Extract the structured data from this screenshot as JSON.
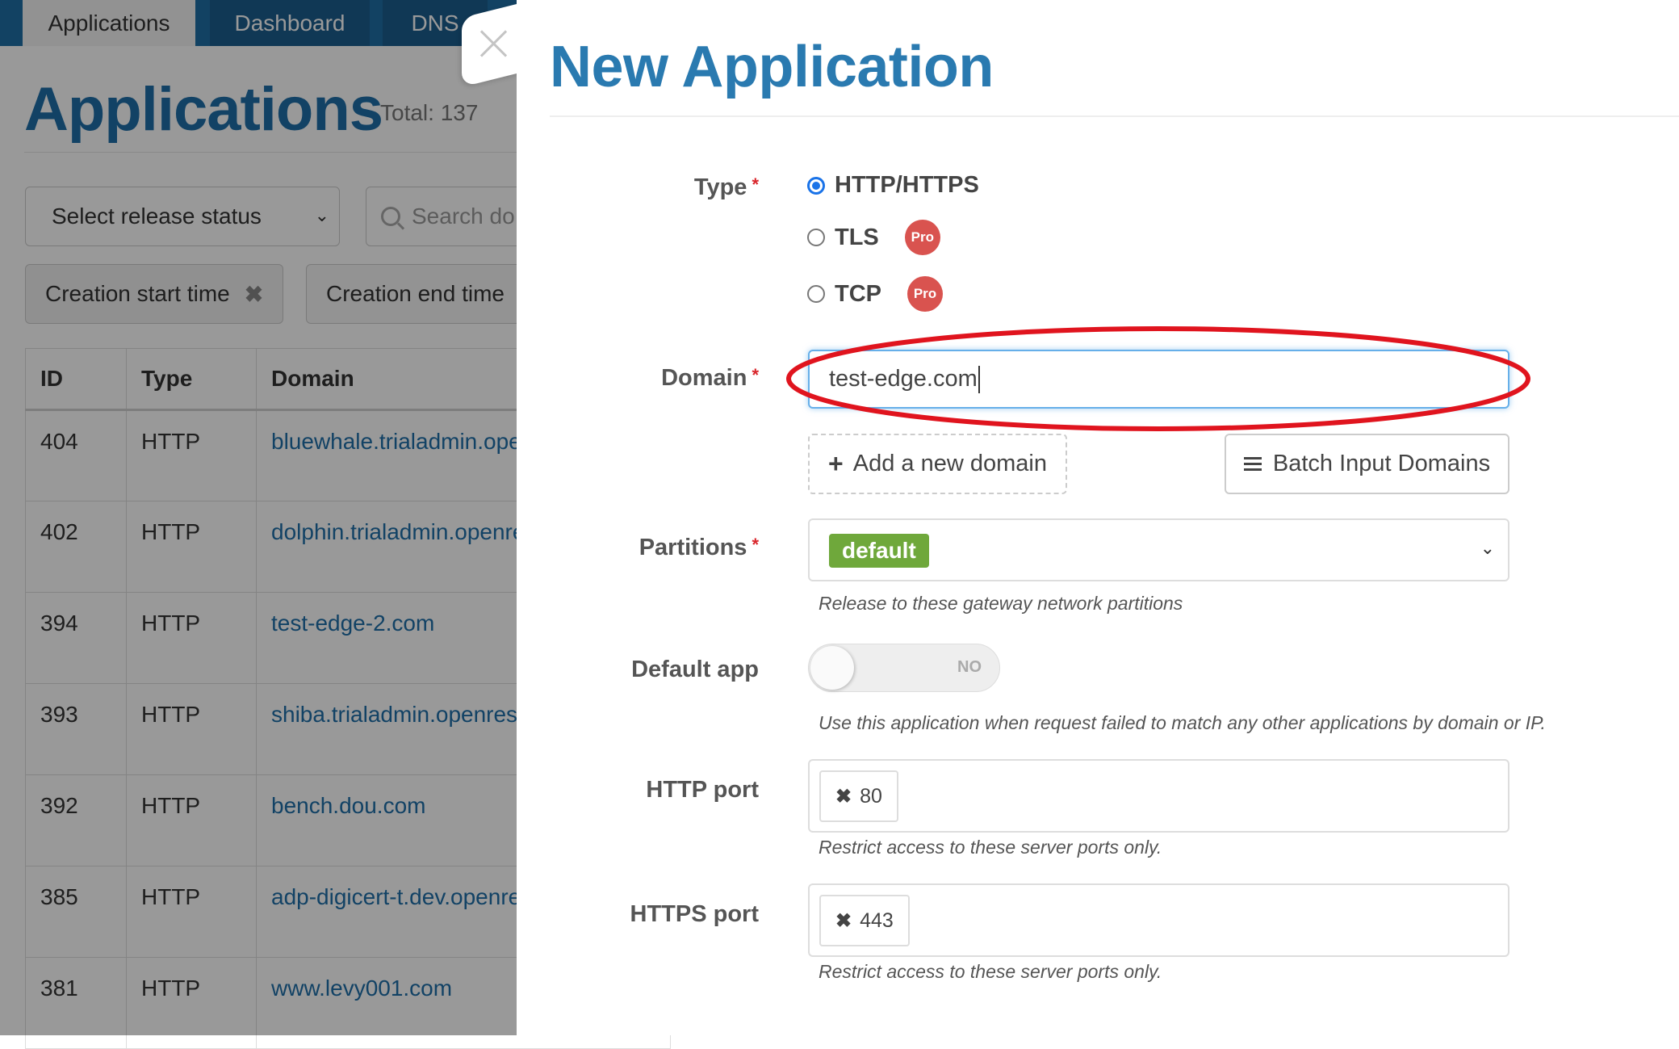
{
  "background_page": {
    "nav_tabs": [
      {
        "label": "Applications",
        "active": true
      },
      {
        "label": "Dashboard",
        "active": false
      },
      {
        "label": "DNS",
        "active": false
      }
    ],
    "title": "Applications",
    "total": "Total: 137",
    "release_status_select": {
      "value": "Select release status"
    },
    "search": {
      "placeholder": "Search do"
    },
    "date_filters": {
      "start": "Creation start time",
      "end": "Creation end time"
    },
    "table": {
      "columns": [
        "ID",
        "Type",
        "Domain"
      ],
      "rows": [
        {
          "id": "404",
          "type": "HTTP",
          "domain": "bluewhale.trialadmin.openrest"
        },
        {
          "id": "402",
          "type": "HTTP",
          "domain": "dolphin.trialadmin.openresty.c"
        },
        {
          "id": "394",
          "type": "HTTP",
          "domain": "test-edge-2.com"
        },
        {
          "id": "393",
          "type": "HTTP",
          "domain": "shiba.trialadmin.openresty.cor"
        },
        {
          "id": "392",
          "type": "HTTP",
          "domain": "bench.dou.com"
        },
        {
          "id": "385",
          "type": "HTTP",
          "domain": "adp-digicert-t.dev.openresty.c"
        },
        {
          "id": "381",
          "type": "HTTP",
          "domain": "www.levy001.com"
        }
      ]
    }
  },
  "drawer": {
    "title": "New Application",
    "close_icon": "close-icon",
    "required_mark": "*",
    "type": {
      "label": "Type",
      "options": [
        {
          "label": "HTTP/HTTPS",
          "checked": true,
          "badge": ""
        },
        {
          "label": "TLS",
          "checked": false,
          "badge": "Pro"
        },
        {
          "label": "TCP",
          "checked": false,
          "badge": "Pro"
        }
      ]
    },
    "domain": {
      "label": "Domain",
      "value": "test-edge.com",
      "add_button": "Add a new domain",
      "batch_button": "Batch Input Domains"
    },
    "partitions": {
      "label": "Partitions",
      "selected": "default",
      "help": "Release to these gateway network partitions"
    },
    "default_app": {
      "label": "Default app",
      "toggle_state": "NO",
      "help": "Use this application when request failed to match any other applications by domain or IP."
    },
    "http_port": {
      "label": "HTTP port",
      "values": [
        "80"
      ],
      "help": "Restrict access to these server ports only."
    },
    "https_port": {
      "label": "HTTPS port",
      "values": [
        "443"
      ],
      "help": "Restrict access to these server ports only."
    }
  },
  "colors": {
    "brand_blue": "#2a7ab0",
    "nav_blue": "#1e6fa5",
    "pro_badge": "#d9534f",
    "partition_tag": "#6fa83b",
    "required": "#d9262c",
    "annotation": "#e0141e"
  }
}
